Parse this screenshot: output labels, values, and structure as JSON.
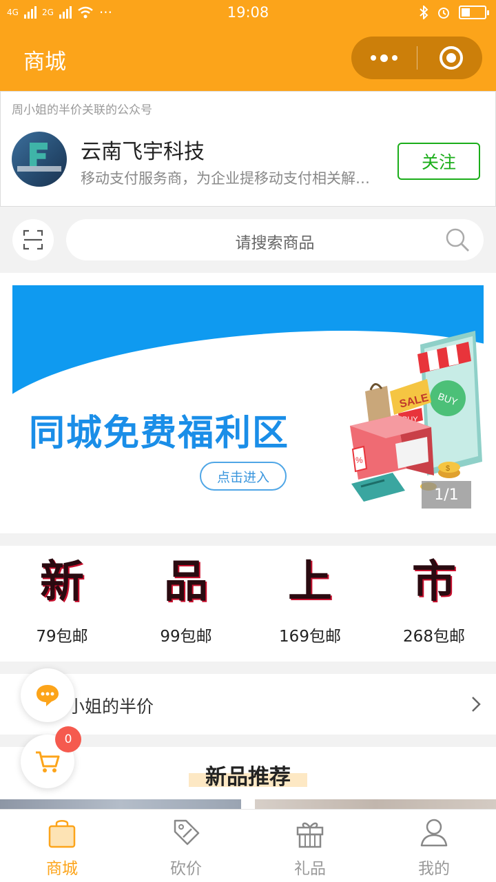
{
  "status_bar": {
    "network_1": "4G",
    "network_2": "2G",
    "more": "···",
    "time": "19:08"
  },
  "nav": {
    "title": "商城"
  },
  "official_account": {
    "source": "周小姐的半价关联的公众号",
    "name": "云南飞宇科技",
    "description": "移动支付服务商，为企业提移动支付相关解决方案",
    "follow_label": "关注"
  },
  "search": {
    "placeholder": "请搜索商品"
  },
  "banner": {
    "title": "同城免费福利区",
    "button_label": "点击进入",
    "counter": "1/1",
    "illustration_labels": [
      "SALE",
      "BUY",
      "BUY",
      "%",
      "$"
    ],
    "colors": {
      "sky": "#0f9af0",
      "title": "#1a8ee8"
    }
  },
  "categories": [
    {
      "glyph": "新",
      "label": "79包邮"
    },
    {
      "glyph": "品",
      "label": "99包邮"
    },
    {
      "glyph": "上",
      "label": "169包邮"
    },
    {
      "glyph": "市",
      "label": "268包邮"
    }
  ],
  "shop": {
    "name": "小姐的半价"
  },
  "section": {
    "title": "新品推荐"
  },
  "cart": {
    "count": "0"
  },
  "tabs": [
    {
      "label": "商城",
      "icon": "shopping-bag-icon",
      "active": true
    },
    {
      "label": "砍价",
      "icon": "price-tag-icon",
      "active": false
    },
    {
      "label": "礼品",
      "icon": "gift-icon",
      "active": false
    },
    {
      "label": "我的",
      "icon": "user-icon",
      "active": false
    }
  ],
  "colors": {
    "brand": "#fca41a",
    "follow_green": "#1aad19",
    "badge_red": "#f55a4e"
  }
}
